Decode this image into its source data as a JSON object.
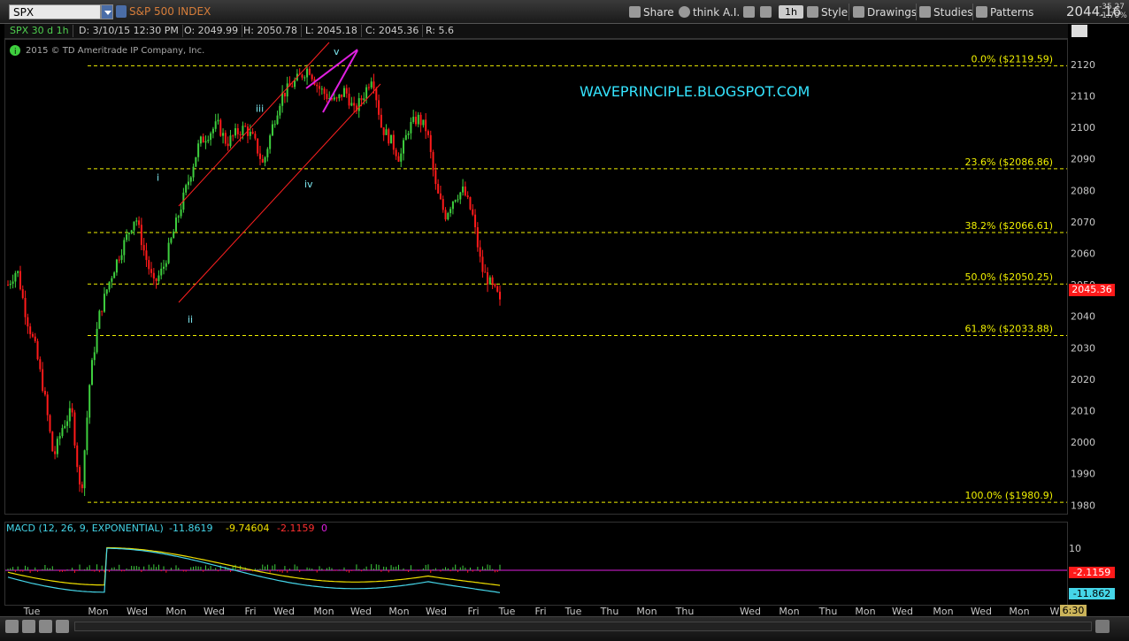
{
  "toolbar": {
    "symbol": "SPX",
    "symbol_name": "S&P 500 INDEX",
    "share_label": "Share",
    "think_ai_label": "think A.I.",
    "aggregation": "1h",
    "style_label": "Style",
    "drawings_label": "Drawings",
    "studies_label": "Studies",
    "patterns_label": "Patterns",
    "last_price": "2044.16",
    "net_change": "-35.27",
    "percent_change": "-1.70%"
  },
  "info_bar": {
    "chart_spec": "SPX 30 d 1h",
    "date": "D: 3/10/15 12:30 PM",
    "open": "O: 2049.99",
    "high": "H: 2050.78",
    "low": "L: 2045.18",
    "close": "C: 2045.36",
    "range": "R: 5.6"
  },
  "copyright": "2015 © TD Ameritrade IP Company, Inc.",
  "watermark": "WAVEPRINCIPLE.BLOGSPOT.COM",
  "price_label": "2045.36",
  "macd": {
    "title": "MACD (12, 26, 9, EXPONENTIAL)",
    "value": "-11.8619",
    "avg": "-9.74604",
    "diff": "-2.1159",
    "zero": "0",
    "axis_label": "10",
    "diff_label": "-2.1159",
    "value_label": "-11.862"
  },
  "time_display": "6:30",
  "colors": {
    "up": "#3ecf3e",
    "down": "#ff1a1a",
    "fib": "#f0f000",
    "channel": "#ff2020",
    "wedge": "#e020e0",
    "wave_label": "#7ee8f0",
    "axis_text": "#c8c8c8",
    "watermark": "#35e4ff",
    "macd_value": "#45d5e8",
    "macd_avg": "#f0e000"
  },
  "chart_data": {
    "type": "candlestick",
    "y_ticks": [
      2120,
      2110,
      2100,
      2090,
      2080,
      2070,
      2060,
      2050,
      2040,
      2030,
      2020,
      2010,
      2000,
      1990,
      1980
    ],
    "ylim": [
      1977,
      2127
    ],
    "x_labels": [
      "Tue",
      "Mon",
      "Wed",
      "Mon",
      "Wed",
      "Fri",
      "Wed",
      "Mon",
      "Wed",
      "Mon",
      "Wed",
      "Fri",
      "Tue",
      "Fri",
      "Tue",
      "Thu",
      "Mon",
      "Thu",
      "Wed",
      "Mon",
      "Thu",
      "Mon",
      "Wed",
      "Mon",
      "Wed",
      "Mon",
      "W"
    ],
    "fib_levels": [
      {
        "label": "0.0% ($2119.59)",
        "value": 2119.59
      },
      {
        "label": "23.6% ($2086.86)",
        "value": 2086.86
      },
      {
        "label": "38.2% ($2066.61)",
        "value": 2066.61
      },
      {
        "label": "50.0% ($2050.25)",
        "value": 2050.25
      },
      {
        "label": "61.8% ($2033.88)",
        "value": 2033.88
      },
      {
        "label": "100.0% ($1980.9)",
        "value": 1980.9
      }
    ],
    "wave_labels": [
      {
        "text": "i",
        "price": 2083
      },
      {
        "text": "ii",
        "price": 2038
      },
      {
        "text": "iii",
        "price": 2105
      },
      {
        "text": "iv",
        "price": 2081
      },
      {
        "text": "v",
        "price": 2123
      }
    ],
    "price_path": [
      2050,
      2055,
      2040,
      2030,
      2015,
      1995,
      2005,
      2010,
      1982,
      2020,
      2040,
      2050,
      2058,
      2065,
      2072,
      2060,
      2050,
      2055,
      2065,
      2075,
      2085,
      2095,
      2098,
      2101,
      2095,
      2098,
      2100,
      2096,
      2088,
      2100,
      2110,
      2113,
      2116,
      2119,
      2113,
      2110,
      2108,
      2112,
      2105,
      2110,
      2117,
      2100,
      2096,
      2090,
      2100,
      2103,
      2099,
      2080,
      2072,
      2078,
      2080,
      2072,
      2055,
      2050,
      2045.36
    ]
  }
}
